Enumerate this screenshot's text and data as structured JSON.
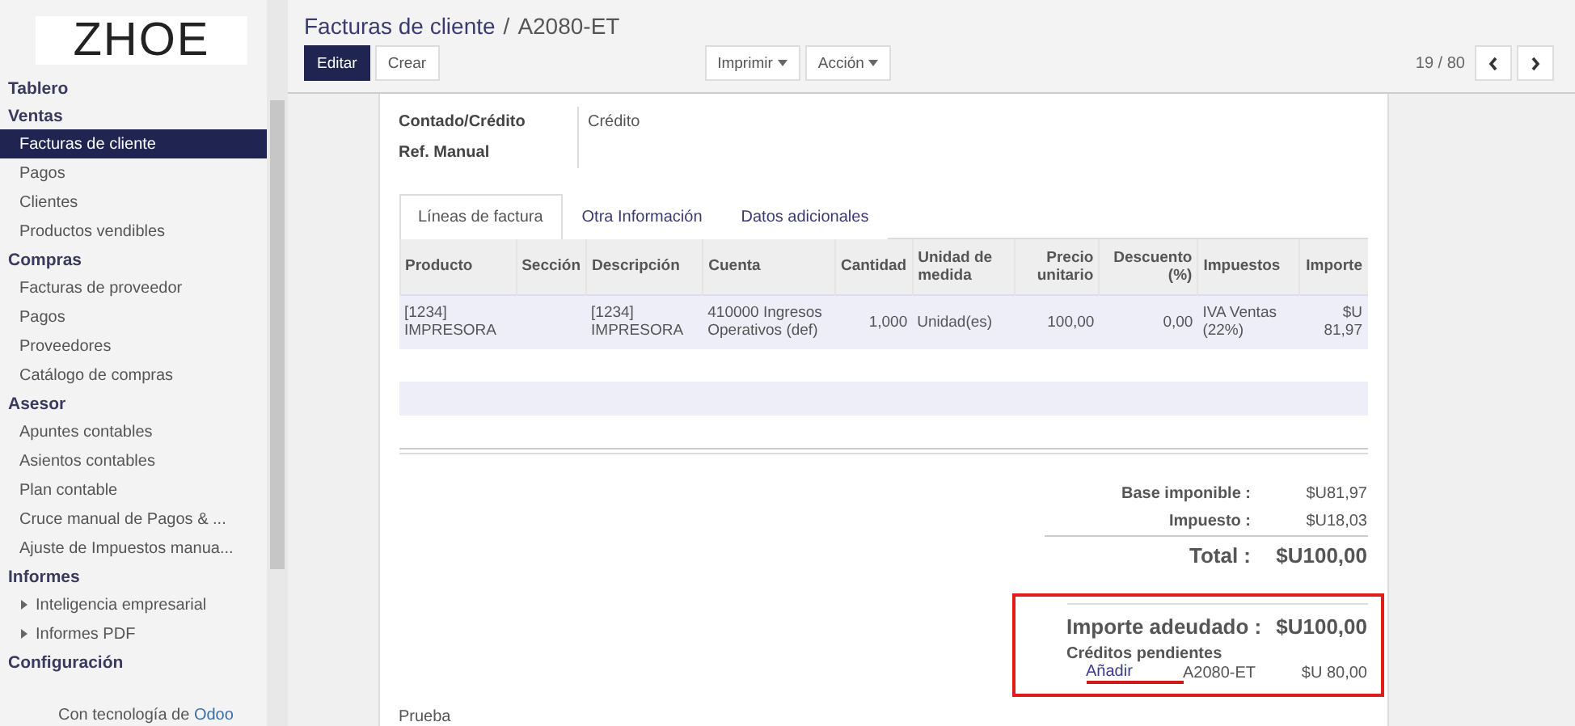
{
  "sidebar": {
    "logo": "ZHOE",
    "sections": [
      {
        "title": "Tablero"
      },
      {
        "title": "Ventas",
        "items": [
          {
            "label": "Facturas de cliente",
            "selected": true,
            "kind": "link"
          },
          {
            "label": "Pagos",
            "selected": false,
            "kind": "link"
          },
          {
            "label": "Clientes",
            "selected": false,
            "kind": "link"
          },
          {
            "label": "Productos vendibles",
            "selected": false,
            "kind": "link"
          }
        ]
      },
      {
        "title": "Compras",
        "items": [
          {
            "label": "Facturas de proveedor",
            "selected": false,
            "kind": "link"
          },
          {
            "label": "Pagos",
            "selected": false,
            "kind": "link"
          },
          {
            "label": "Proveedores",
            "selected": false,
            "kind": "link"
          },
          {
            "label": "Catálogo de compras",
            "selected": false,
            "kind": "link"
          }
        ]
      },
      {
        "title": "Asesor",
        "items": [
          {
            "label": "Apuntes contables",
            "selected": false,
            "kind": "link"
          },
          {
            "label": "Asientos contables",
            "selected": false,
            "kind": "link"
          },
          {
            "label": "Plan contable",
            "selected": false,
            "kind": "link"
          },
          {
            "label": "Cruce manual de Pagos & ...",
            "selected": false,
            "kind": "link"
          },
          {
            "label": "Ajuste de Impuestos manua...",
            "selected": false,
            "kind": "link"
          }
        ]
      },
      {
        "title": "Informes",
        "items": [
          {
            "label": "Inteligencia empresarial",
            "selected": false,
            "kind": "folder"
          },
          {
            "label": "Informes PDF",
            "selected": false,
            "kind": "folder"
          }
        ]
      },
      {
        "title": "Configuración"
      }
    ],
    "footer": {
      "text": "Con tecnología de ",
      "brand": "Odoo"
    }
  },
  "header": {
    "breadcrumb": "Facturas de cliente",
    "separator": "/",
    "title": "A2080-ET",
    "primary_button": "Editar",
    "secondary_button": "Crear",
    "dropdowns": [
      "Imprimir",
      "Acción"
    ],
    "pager": "19 / 80"
  },
  "form": {
    "fields": [
      {
        "label": "Contado/Crédito",
        "value": "Crédito"
      },
      {
        "label": "Ref. Manual"
      }
    ],
    "tabs": [
      {
        "label": "Líneas de factura",
        "selected": true
      },
      {
        "label": "Otra Información",
        "selected": false
      },
      {
        "label": "Datos adicionales",
        "selected": false
      }
    ],
    "table": {
      "columns": [
        {
          "label": "Producto",
          "kind": "text"
        },
        {
          "label": "Sección",
          "kind": "text"
        },
        {
          "label": "Descripción",
          "kind": "text"
        },
        {
          "label": "Cuenta",
          "kind": "text"
        },
        {
          "label": "Cantidad",
          "kind": "number"
        },
        {
          "label": "Unidad de medida",
          "kind": "text"
        },
        {
          "label": "Precio unitario",
          "kind": "number"
        },
        {
          "label": "Descuento (%)",
          "kind": "number"
        },
        {
          "label": "Impuestos",
          "kind": "text"
        },
        {
          "label": "Importe",
          "kind": "number"
        }
      ],
      "rows": [
        [
          "[1234] IMPRESORA",
          "",
          "[1234] IMPRESORA",
          "410000 Ingresos Operativos (def)",
          "1,000",
          "Unidad(es)",
          "100,00",
          "0,00",
          "IVA Ventas (22%)",
          "$U 81,97"
        ]
      ]
    },
    "totals": [
      {
        "label": "Base imponible :",
        "value": "$U81,97",
        "kind": "line"
      },
      {
        "label": "Impuesto :",
        "value": "$U18,03",
        "kind": "line"
      },
      {
        "label": "Total :",
        "value": "$U100,00",
        "kind": "total"
      }
    ],
    "amount_due": {
      "label": "Importe adeudado :",
      "value": "$U100,00",
      "highlighted": true
    },
    "credits": {
      "title": "Créditos pendientes",
      "items": [
        {
          "action": "Añadir",
          "reference": "A2080-ET",
          "amount": "$U 80,00",
          "underlined": true
        }
      ]
    },
    "note": "Prueba"
  }
}
